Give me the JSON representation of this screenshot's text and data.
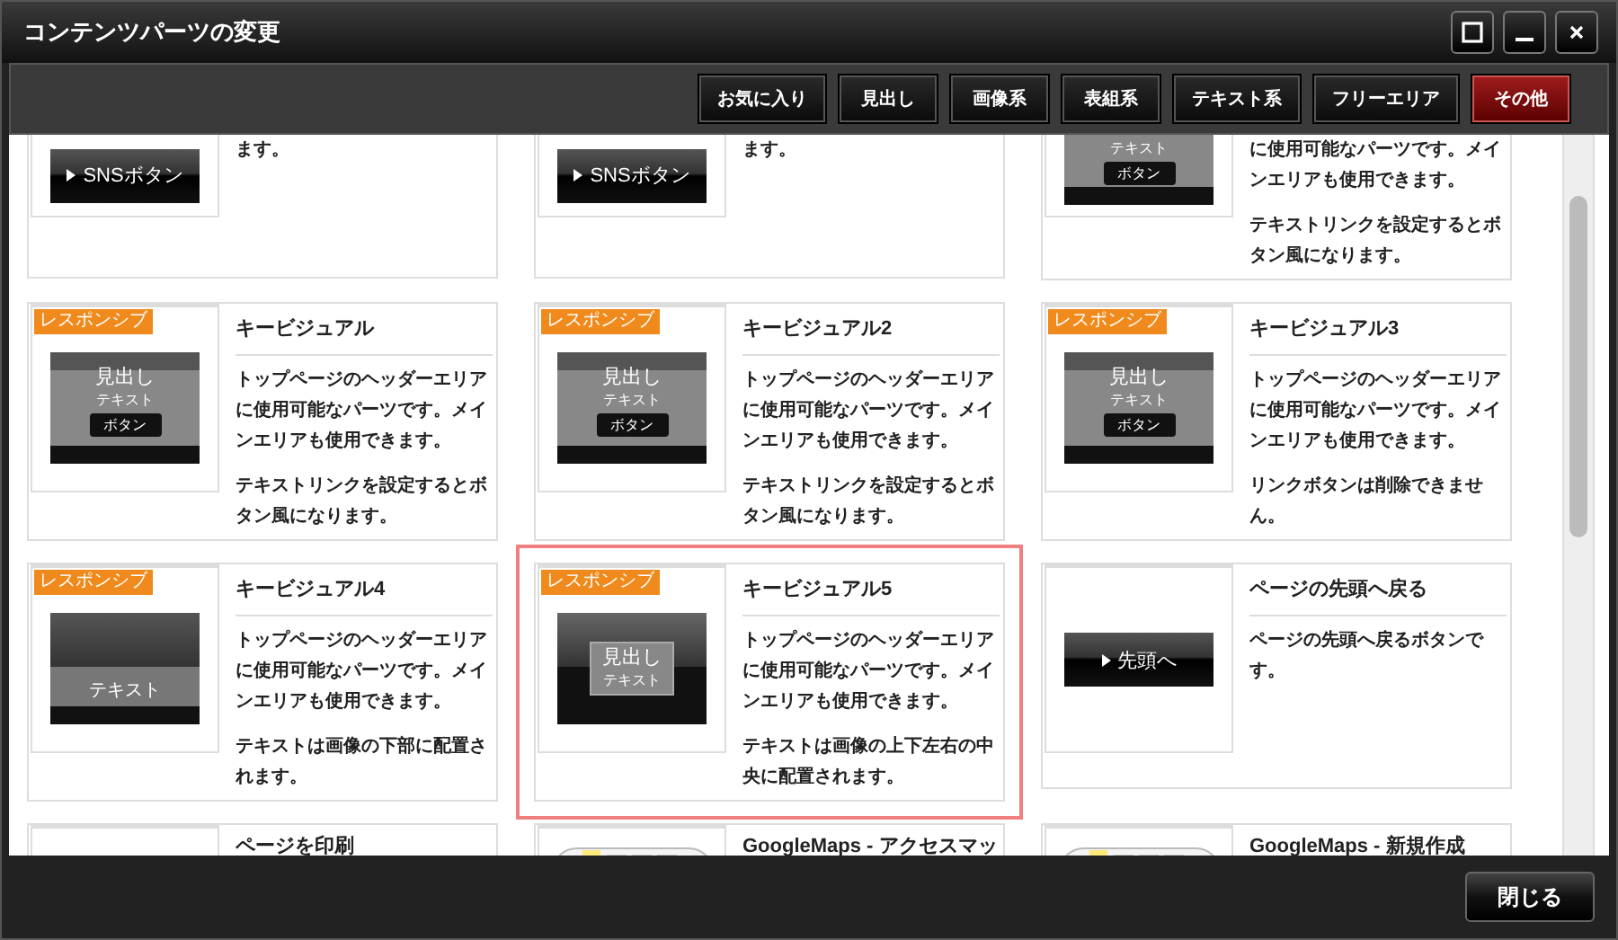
{
  "window": {
    "title": "コンテンツパーツの変更"
  },
  "tabs": [
    {
      "label": "お気に入り",
      "selected": false
    },
    {
      "label": "見出し",
      "selected": false
    },
    {
      "label": "画像系",
      "selected": false
    },
    {
      "label": "表組系",
      "selected": false
    },
    {
      "label": "テキスト系",
      "selected": false
    },
    {
      "label": "フリーエリア",
      "selected": false
    },
    {
      "label": "その他",
      "selected": true
    }
  ],
  "rows": [
    {
      "cards": [
        {
          "responsive": false,
          "selected": false,
          "thumb": {
            "kind": "sns",
            "labels": [
              "SNSボタン"
            ]
          },
          "description": [
            "ます。"
          ]
        },
        {
          "responsive": false,
          "selected": false,
          "thumb": {
            "kind": "sns",
            "labels": [
              "SNSボタン"
            ]
          },
          "description": [
            "ます。"
          ]
        },
        {
          "responsive": false,
          "selected": false,
          "thumb": {
            "kind": "kv_top_cut",
            "labels": [
              "テキスト",
              "ボタン"
            ]
          },
          "description": [
            "に使用可能なパーツです。メインエリアも使用できます。",
            "テキストリンクを設定するとボタン風になります。"
          ]
        }
      ]
    },
    {
      "cards": [
        {
          "responsive": true,
          "badge": "レスポンシブ",
          "selected": false,
          "title": "キービジュアル",
          "thumb": {
            "kind": "kv",
            "labels": [
              "見出し",
              "テキスト",
              "ボタン"
            ]
          },
          "description": [
            "トップページのヘッダーエリアに使用可能なパーツです。メインエリアも使用できます。",
            "テキストリンクを設定するとボタン風になります。"
          ]
        },
        {
          "responsive": true,
          "badge": "レスポンシブ",
          "selected": false,
          "title": "キービジュアル2",
          "thumb": {
            "kind": "kv",
            "labels": [
              "見出し",
              "テキスト",
              "ボタン"
            ]
          },
          "description": [
            "トップページのヘッダーエリアに使用可能なパーツです。メインエリアも使用できます。",
            "テキストリンクを設定するとボタン風になります。"
          ]
        },
        {
          "responsive": true,
          "badge": "レスポンシブ",
          "selected": false,
          "title": "キービジュアル3",
          "thumb": {
            "kind": "kv",
            "labels": [
              "見出し",
              "テキスト",
              "ボタン"
            ]
          },
          "description": [
            "トップページのヘッダーエリアに使用可能なパーツです。メインエリアも使用できます。",
            "リンクボタンは削除できません。"
          ]
        }
      ]
    },
    {
      "cards": [
        {
          "responsive": true,
          "badge": "レスポンシブ",
          "selected": false,
          "title": "キービジュアル4",
          "thumb": {
            "kind": "kv_bottom",
            "labels": [
              "テキスト"
            ]
          },
          "description": [
            "トップページのヘッダーエリアに使用可能なパーツです。メインエリアも使用できます。",
            "テキストは画像の下部に配置されます。"
          ]
        },
        {
          "responsive": true,
          "badge": "レスポンシブ",
          "selected": true,
          "title": "キービジュアル5",
          "thumb": {
            "kind": "kv_center",
            "labels": [
              "見出し",
              "テキスト"
            ]
          },
          "description": [
            "トップページのヘッダーエリアに使用可能なパーツです。メインエリアも使用できます。",
            "テキストは画像の上下左右の中央に配置されます。"
          ]
        },
        {
          "responsive": false,
          "selected": false,
          "title": "ページの先頭へ戻る",
          "thumb": {
            "kind": "top_button",
            "labels": [
              "先頭へ"
            ]
          },
          "description": [
            "ページの先頭へ戻るボタンです。"
          ]
        }
      ]
    },
    {
      "cards": [
        {
          "responsive": false,
          "selected": false,
          "title": "ページを印刷",
          "thumb": {
            "kind": "blank"
          }
        },
        {
          "responsive": false,
          "selected": false,
          "title": "GoogleMaps - アクセスマッ",
          "thumb": {
            "kind": "map"
          }
        },
        {
          "responsive": false,
          "selected": false,
          "title": "GoogleMaps - 新規作成",
          "thumb": {
            "kind": "map"
          }
        }
      ]
    }
  ],
  "footer": {
    "close_button": "閉じる"
  }
}
